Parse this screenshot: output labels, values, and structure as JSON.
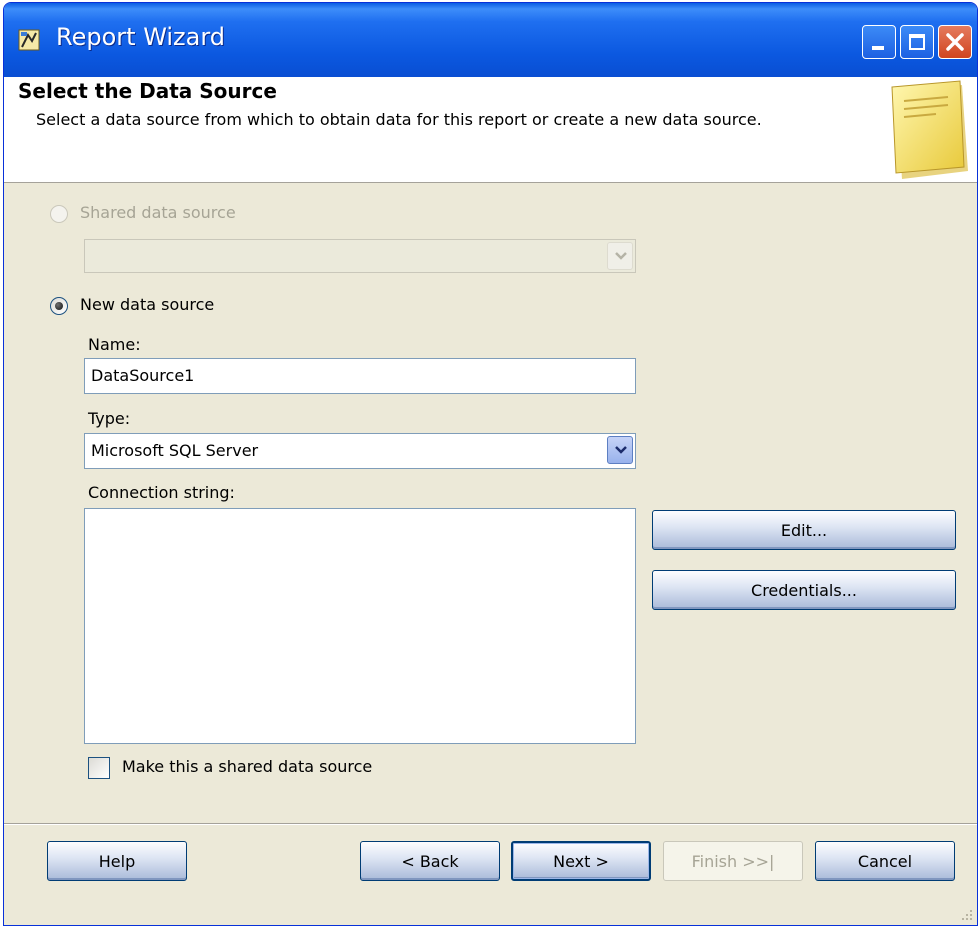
{
  "window": {
    "title": "Report Wizard"
  },
  "header": {
    "title": "Select the Data Source",
    "description": "Select a data source from which to obtain data for this report or create a new data source."
  },
  "shared_source": {
    "label": "Shared data source",
    "selected": false,
    "enabled": false,
    "value": ""
  },
  "new_source": {
    "label": "New data source",
    "selected": true,
    "name_label": "Name:",
    "name_value": "DataSource1",
    "type_label": "Type:",
    "type_value": "Microsoft SQL Server",
    "connection_label": "Connection string:",
    "connection_value": "",
    "edit_button": "Edit...",
    "credentials_button": "Credentials...",
    "shared_checkbox_label": "Make this a shared data source",
    "shared_checkbox_checked": false
  },
  "footer": {
    "help": "Help",
    "back": "< Back",
    "next": "Next >",
    "finish": "Finish >>|",
    "cancel": "Cancel"
  },
  "colors": {
    "titlebar": "#0a5ee3",
    "dialog_bg": "#ece9d8",
    "close_button": "#d0451f"
  }
}
